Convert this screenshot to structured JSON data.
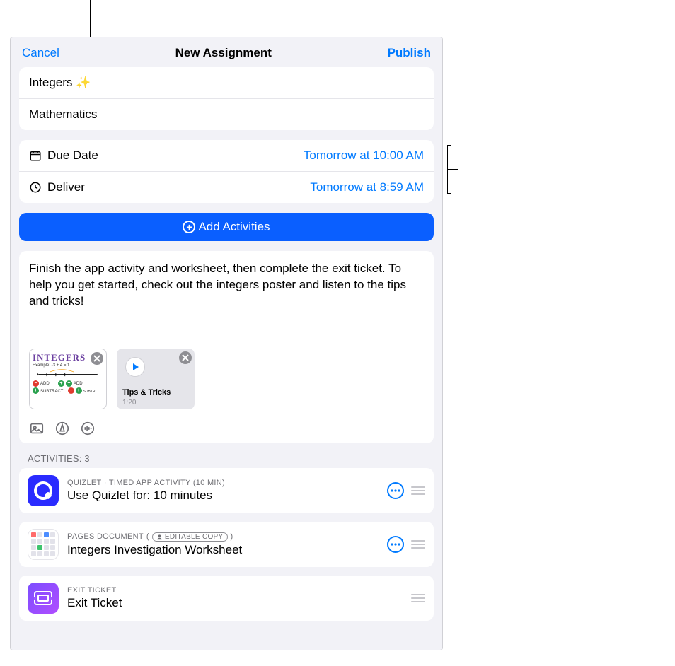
{
  "nav": {
    "cancel": "Cancel",
    "title": "New Assignment",
    "publish": "Publish"
  },
  "assignment": {
    "name": "Integers ✨",
    "class": "Mathematics"
  },
  "due": {
    "label": "Due Date",
    "value": "Tomorrow at 10:00 AM"
  },
  "deliver": {
    "label": "Deliver",
    "value": "Tomorrow at 8:59 AM"
  },
  "add_activities": "Add Activities",
  "instructions": "Finish the app activity and worksheet, then complete the exit ticket. To help you get started, check out the integers poster and listen to the tips and tricks!",
  "attachments": {
    "0": {
      "poster_title": "INTEGERS",
      "example_label": "Example: -3 + 4 = 1",
      "add_label": "ADD",
      "subtract_label": "SUBTRACT"
    },
    "1": {
      "title": "Tips & Tricks",
      "duration": "1:20"
    }
  },
  "activities_header": "ACTIVITIES: 3",
  "activities": {
    "0": {
      "meta": "QUIZLET · TIMED APP ACTIVITY (10 MIN)",
      "title": "Use Quizlet for: 10 minutes"
    },
    "1": {
      "meta_prefix": "PAGES DOCUMENT  ",
      "editable_label": "EDITABLE COPY",
      "title": "Integers Investigation Worksheet"
    },
    "2": {
      "meta": "EXIT TICKET",
      "title": "Exit Ticket"
    }
  }
}
